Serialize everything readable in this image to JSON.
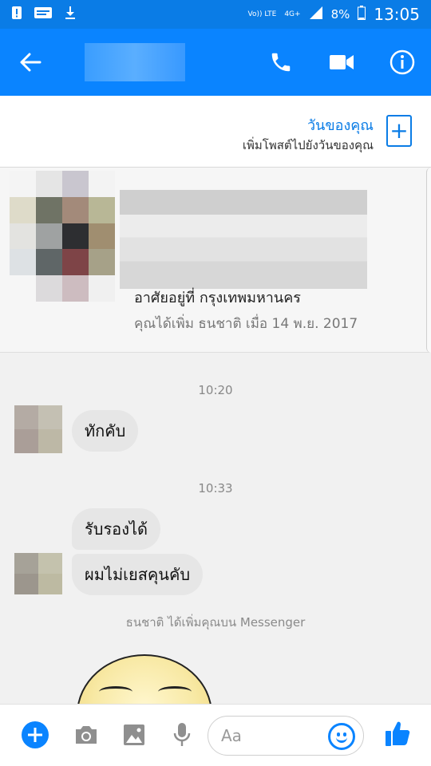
{
  "status_bar": {
    "network_top": "4G+",
    "volte": "Vo)) LTE",
    "battery": "8%",
    "time": "13:05",
    "icons": [
      "alert-icon",
      "webtoon-icon",
      "download-icon",
      "wifi-icon",
      "signal-icon",
      "battery-icon"
    ]
  },
  "header": {
    "back_icon": "arrow-left-icon",
    "actions": [
      "phone-icon",
      "video-icon",
      "info-icon"
    ]
  },
  "story": {
    "title": "วันของคุณ",
    "subtitle": "เพิ่มโพสต์ไปยังวันของคุณ",
    "add_icon": "plus-box-icon"
  },
  "profile": {
    "lives_in": "อาศัยอยู่ที่ กรุงเทพมหานคร",
    "added": "คุณได้เพิ่ม ธนชาติ เมื่อ 14 พ.ย. 2017"
  },
  "messages": {
    "time1": "10:20",
    "msg1": "ทักคับ",
    "time2": "10:33",
    "msg2": "รับรองได้",
    "msg3": "ผมไม่เยสคุนคับ",
    "system": "ธนชาติ ได้เพิ่มคุณบน Messenger"
  },
  "composer": {
    "placeholder": "Aa",
    "icons": [
      "plus-circle-icon",
      "camera-icon",
      "image-icon",
      "mic-icon",
      "emoji-icon",
      "thumbs-up-icon"
    ]
  },
  "colors": {
    "brand": "#0a84ff",
    "status": "#0a7ce6",
    "bubble": "#e6e6e6"
  }
}
